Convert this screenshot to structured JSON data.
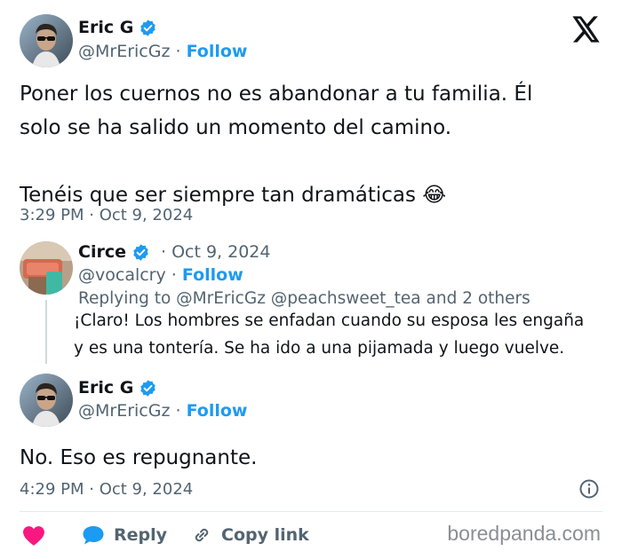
{
  "main_tweet": {
    "author_name": "Eric G",
    "author_handle": "@MrEricGz",
    "follow_label": "Follow",
    "text_line1": "Poner los cuernos no es abandonar a tu familia. Él",
    "text_line2": "solo se ha salido un momento del camino.",
    "text_line3": "Tenéis que ser siempre tan dramáticas",
    "emoji": "😂",
    "timestamp": "3:29 PM · Oct 9, 2024"
  },
  "quoted_tweet": {
    "author_name": "Circe",
    "date": "· Oct 9, 2024",
    "author_handle": "@vocalcry",
    "follow_label": "Follow",
    "replying_to": "Replying to @MrEricGz @peachsweet_tea and 2 others",
    "text_line1": "¡Claro! Los hombres se enfadan cuando su esposa les engaña",
    "text_line2": "y es una tontería. Se ha ido a una pijamada y luego vuelve."
  },
  "reply_tweet": {
    "author_name": "Eric G",
    "author_handle": "@MrEricGz",
    "follow_label": "Follow",
    "text": "No. Eso es repugnante.",
    "timestamp": "4:29 PM · Oct 9, 2024"
  },
  "actions": {
    "reply_label": "Reply",
    "copy_link_label": "Copy link"
  },
  "watermark": "boredpanda.com",
  "colors": {
    "accent": "#1d9bf0",
    "like": "#f91880",
    "secondary_text": "#536471"
  }
}
